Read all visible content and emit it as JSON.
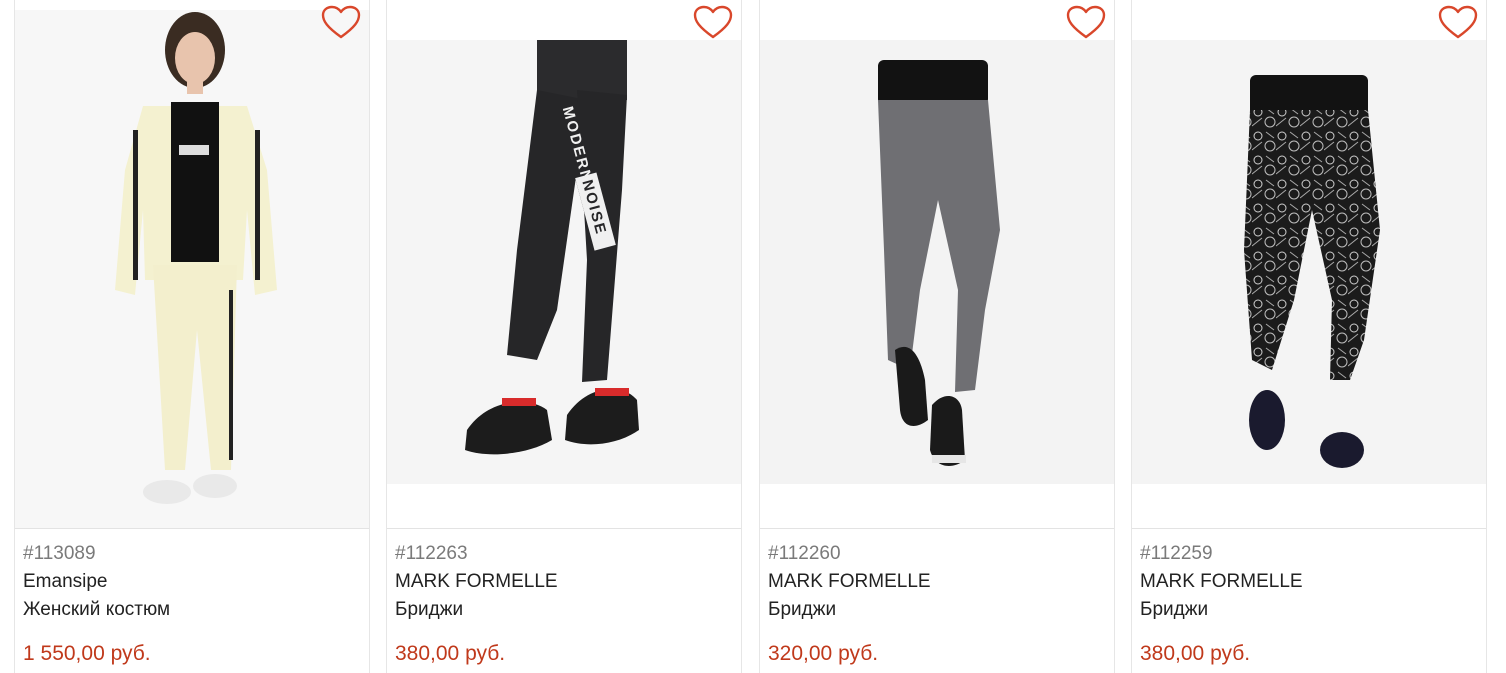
{
  "accent_color": "#c0391b",
  "products": [
    {
      "sku": "#113089",
      "brand": "Emansipe",
      "type": "Женский костюм",
      "price": "1 550,00 руб.",
      "wishlist_icon": "heart-outline-icon"
    },
    {
      "sku": "#112263",
      "brand": "MARK FORMELLE",
      "type": "Бриджи",
      "price": "380,00 руб.",
      "wishlist_icon": "heart-outline-icon",
      "print_text": "MODERN NOISE"
    },
    {
      "sku": "#112260",
      "brand": "MARK FORMELLE",
      "type": "Бриджи",
      "price": "320,00 руб.",
      "wishlist_icon": "heart-outline-icon"
    },
    {
      "sku": "#112259",
      "brand": "MARK FORMELLE",
      "type": "Бриджи",
      "price": "380,00 руб.",
      "wishlist_icon": "heart-outline-icon"
    }
  ]
}
